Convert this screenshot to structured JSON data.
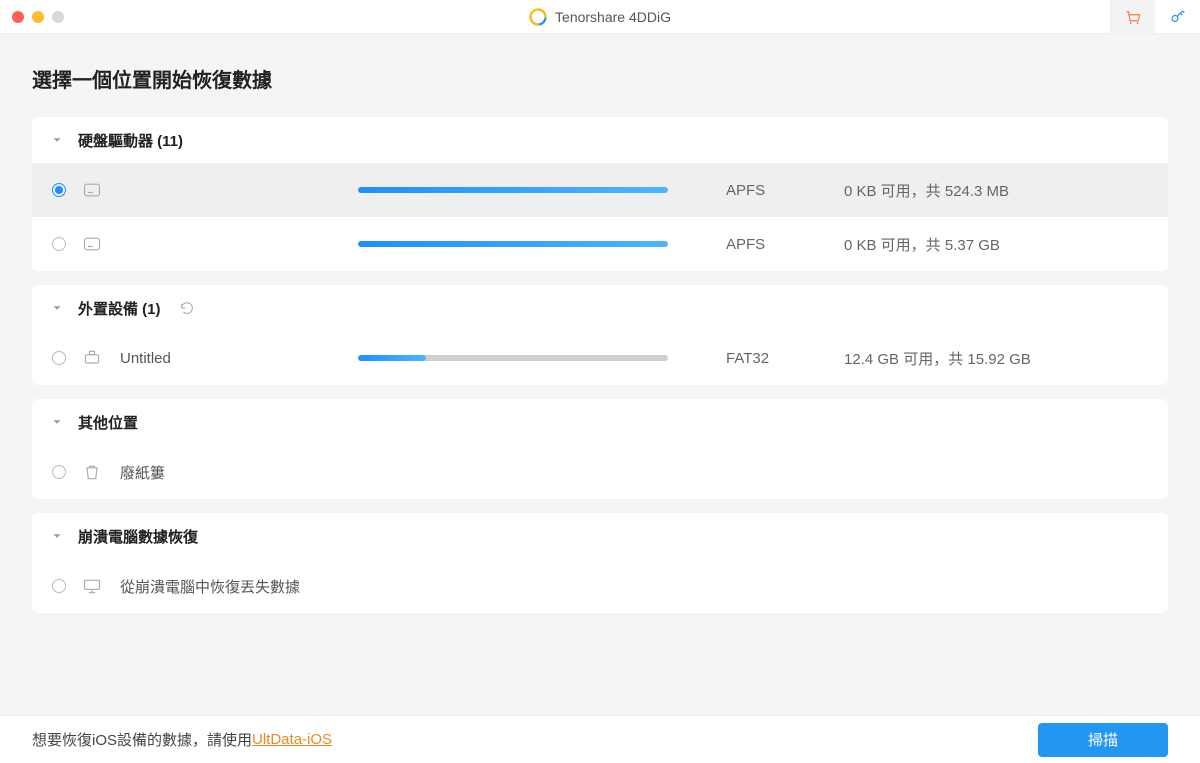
{
  "app_title": "Tenorshare 4DDiG",
  "page_title": "選擇一個位置開始恢復數據",
  "groups": {
    "drives": {
      "header": "硬盤驅動器 (11)",
      "items": [
        {
          "name": "",
          "fs": "APFS",
          "capacity": "0 KB 可用，共 524.3 MB",
          "fill_pct": 100,
          "selected": true
        },
        {
          "name": "",
          "fs": "APFS",
          "capacity": "0 KB 可用，共 5.37 GB",
          "fill_pct": 100,
          "selected": false
        }
      ]
    },
    "external": {
      "header": "外置設備 (1)",
      "items": [
        {
          "name": "Untitled",
          "fs": "FAT32",
          "capacity": "12.4 GB 可用，共 15.92 GB",
          "fill_pct": 22,
          "selected": false
        }
      ]
    },
    "other": {
      "header": "其他位置",
      "items": [
        {
          "name": "廢紙簍"
        }
      ]
    },
    "crash": {
      "header": "崩潰電腦數據恢復",
      "items": [
        {
          "name": "從崩潰電腦中恢復丟失數據"
        }
      ]
    }
  },
  "footer_note_prefix": "想要恢復iOS設備的數據，請使用",
  "footer_note_link": "UltData-iOS",
  "scan_label": "掃描"
}
